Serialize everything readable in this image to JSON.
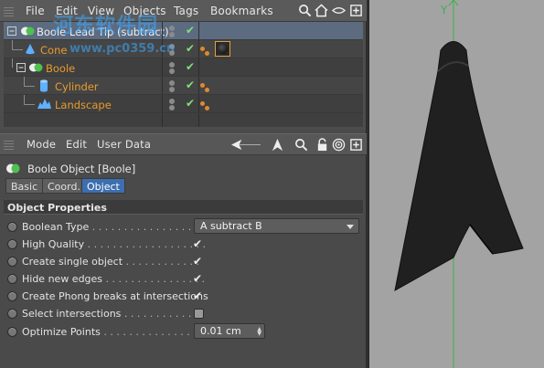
{
  "object_manager": {
    "menu": [
      "File",
      "Edit",
      "View",
      "Objects",
      "Tags",
      "Bookmarks"
    ],
    "objects": [
      {
        "label": "Boole Lead Tip (subtract)",
        "selected": true
      },
      {
        "label": "Cone"
      },
      {
        "label": "Boole"
      },
      {
        "label": "Cylinder"
      },
      {
        "label": "Landscape"
      }
    ]
  },
  "attribute_manager": {
    "menu": [
      "Mode",
      "Edit",
      "User Data"
    ],
    "title": "Boole Object [Boole]",
    "tabs": [
      "Basic",
      "Coord.",
      "Object"
    ],
    "active_tab": "Object",
    "section": "Object Properties",
    "properties": {
      "boolean_type": {
        "label": "Boolean Type",
        "dots": " . . . . . . . . . . . . . . . .",
        "value": "A subtract B"
      },
      "high_quality": {
        "label": "High Quality",
        "dots": " . . . . . . . . . . . . . . . . . . .",
        "checked": true
      },
      "create_single_object": {
        "label": "Create single object",
        "dots": " . . . . . . . . . . . .",
        "checked": true
      },
      "hide_new_edges": {
        "label": "Hide new edges",
        "dots": " . . . . . . . . . . . . . . . .",
        "checked": true
      },
      "phong_breaks": {
        "label": "Create Phong breaks at intersections",
        "dots": "",
        "checked": true
      },
      "select_intersections": {
        "label": "Select intersections",
        "dots": " . . . . . . . . . . . . .",
        "checked": false
      },
      "optimize_points": {
        "label": "Optimize Points",
        "dots": " . . . . . . . . . . . . . . .",
        "value": "0.01 cm"
      }
    }
  },
  "viewport": {
    "axis_label": "Y"
  },
  "watermark": {
    "text": "河东软件园",
    "url": "www.pc0359.cn"
  },
  "colors": {
    "selected_row": "#5c6b80",
    "active_tab": "#3d6fb0",
    "object_label": "#e89b2c",
    "check": "#7ee07e",
    "axis": "#3fb14a"
  }
}
